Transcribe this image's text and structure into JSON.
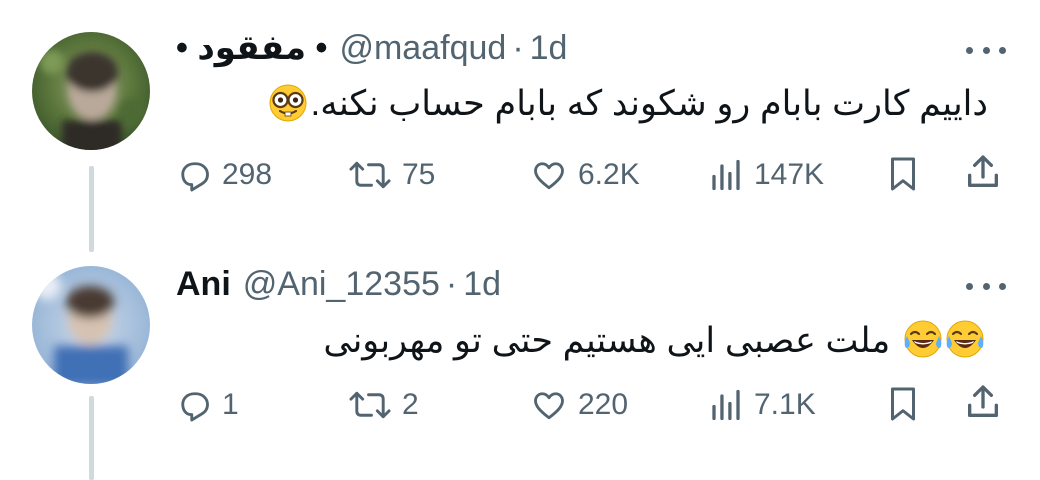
{
  "tweets": [
    {
      "name": "• مفقود •",
      "handle": "@maafqud",
      "separator": "·",
      "time": "1d",
      "text": "داییم کارت بابام رو شکوند که بابام حساب نکنه.",
      "emoji": "nerd-face-emoji",
      "actions": {
        "replies": "298",
        "reposts": "75",
        "likes": "6.2K",
        "views": "147K"
      }
    },
    {
      "name": "Ani",
      "handle": "@Ani_12355",
      "separator": "·",
      "time": "1d",
      "text": "ملت عصبی ایی هستیم حتی تو مهربونی",
      "emoji": "tears-of-joy-emoji",
      "actions": {
        "replies": "1",
        "reposts": "2",
        "likes": "220",
        "views": "7.1K"
      }
    }
  ],
  "icons": [
    "reply-icon",
    "repost-icon",
    "like-icon",
    "views-icon",
    "bookmark-icon",
    "share-icon",
    "more-icon"
  ],
  "colors": {
    "text": "#0f1419",
    "secondary": "#536471",
    "thread_line": "#cfd9de",
    "background": "#ffffff"
  }
}
